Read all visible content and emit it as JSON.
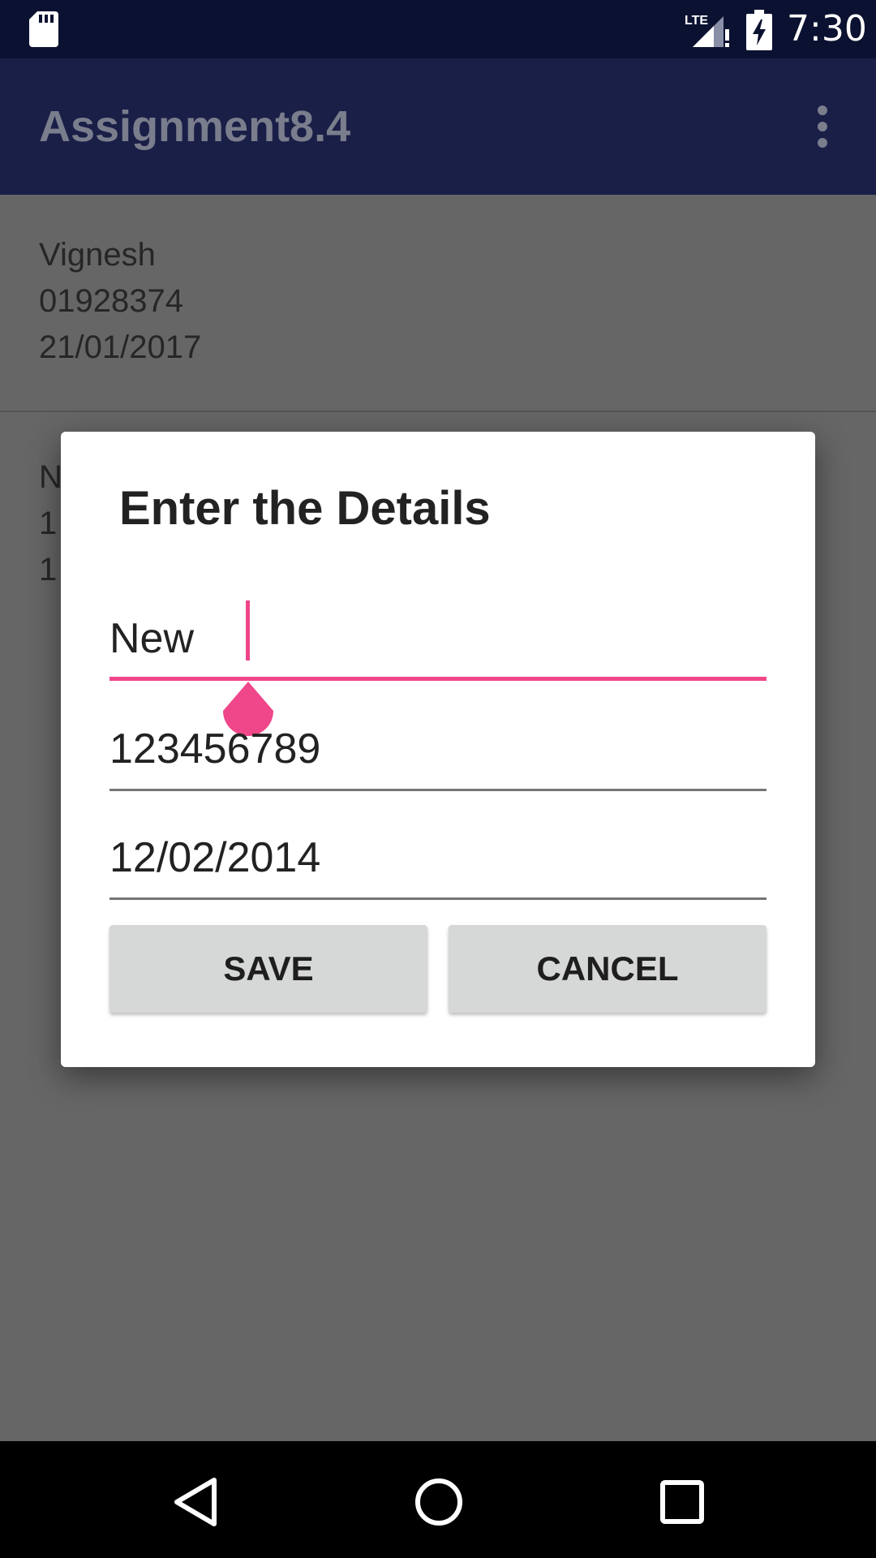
{
  "status_bar": {
    "time": "7:30",
    "network_label": "LTE",
    "icons": [
      "sd-card-icon",
      "lte-signal-icon",
      "battery-charging-icon"
    ]
  },
  "app_bar": {
    "title": "Assignment8.4",
    "overflow_icon": "more-vert-icon"
  },
  "list": {
    "items": [
      {
        "name": "Vignesh",
        "phone": "01928374",
        "date": "21/01/2017"
      },
      {
        "name": "N",
        "phone": "1",
        "date": "1"
      }
    ]
  },
  "dialog": {
    "title": "Enter the Details",
    "fields": {
      "name": {
        "value": "New"
      },
      "phone": {
        "value": "123456789"
      },
      "date": {
        "value": "12/02/2014"
      }
    },
    "buttons": {
      "save": "SAVE",
      "cancel": "CANCEL"
    }
  },
  "nav_bar": {
    "icons": [
      "back-icon",
      "home-icon",
      "recents-icon"
    ]
  },
  "colors": {
    "status_bar": "#0b1130",
    "app_bar": "#1a1f48",
    "accent": "#f0468a",
    "scrim_background": "#666666",
    "button": "#d6d7d7"
  }
}
